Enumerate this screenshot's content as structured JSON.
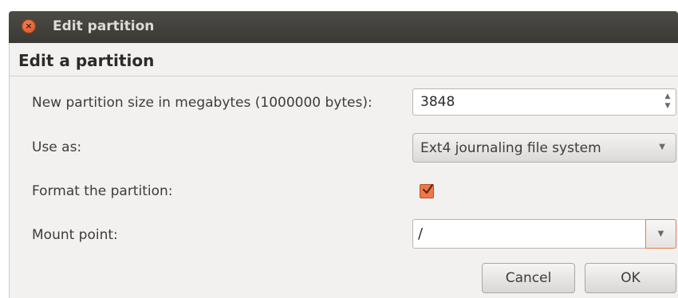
{
  "window": {
    "title": "Edit partition"
  },
  "dialog": {
    "heading": "Edit a partition",
    "size_label": "New partition size in megabytes (1000000 bytes):",
    "size_value": "3848",
    "use_as_label": "Use as:",
    "use_as_value": "Ext4 journaling file system",
    "format_label": "Format the partition:",
    "format_checked": true,
    "mount_label": "Mount point:",
    "mount_value": "/",
    "cancel_label": "Cancel",
    "ok_label": "OK"
  },
  "colors": {
    "titlebar": "#3c3b37",
    "accent": "#f07746",
    "background": "#f2f1f0"
  },
  "icons": {
    "close": "close-icon",
    "spin": "spin-arrows-icon",
    "dropdown": "chevron-down-icon",
    "check": "checkmark-icon"
  }
}
